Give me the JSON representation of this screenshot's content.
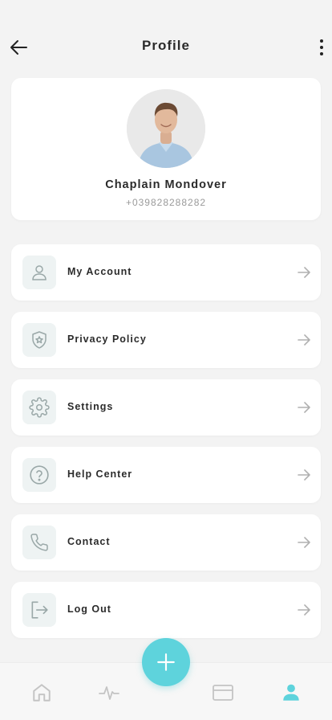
{
  "header": {
    "title": "Profile",
    "back_icon": "arrow-left-icon",
    "more_icon": "more-vertical-icon"
  },
  "profile": {
    "name": "Chaplain Mondover",
    "phone": "+039828288282"
  },
  "menu": [
    {
      "label": "My Account",
      "icon": "user-icon"
    },
    {
      "label": "Privacy Policy",
      "icon": "shield-icon"
    },
    {
      "label": "Settings",
      "icon": "gear-icon"
    },
    {
      "label": "Help Center",
      "icon": "question-icon"
    },
    {
      "label": "Contact",
      "icon": "phone-icon"
    },
    {
      "label": "Log Out",
      "icon": "logout-icon"
    }
  ],
  "bottom_nav": {
    "items": [
      {
        "icon": "home-icon",
        "active": false
      },
      {
        "icon": "activity-icon",
        "active": false
      },
      {
        "icon": "card-icon",
        "active": false
      },
      {
        "icon": "person-icon",
        "active": true
      }
    ],
    "fab_icon": "plus-icon"
  },
  "colors": {
    "accent": "#5ed3dc",
    "icon_muted": "#9aa8a8",
    "icon_bg": "#eef3f3",
    "nav_inactive": "#c4c4c4"
  }
}
